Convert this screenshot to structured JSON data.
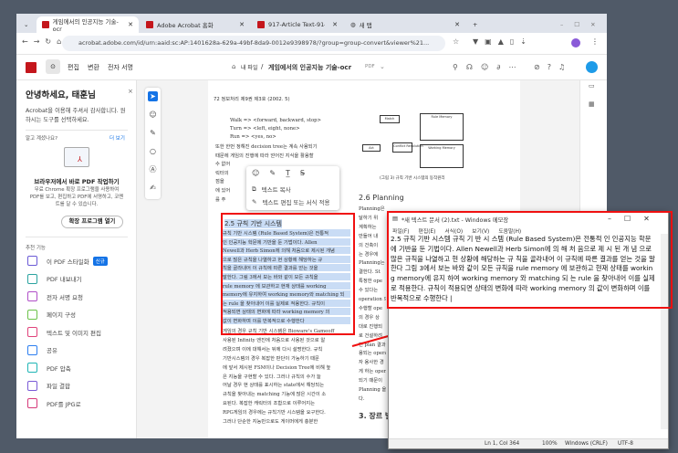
{
  "browser": {
    "tabs": [
      {
        "label": "게임에서의 인공지능 기술-ocr"
      },
      {
        "label": "Adobe Acrobat 홈화"
      },
      {
        "label": "917-Article Text-914-1-10-200"
      },
      {
        "label": "새 탭"
      }
    ],
    "url": "acrobat.adobe.com/id/urn:aaid:sc:AP:1401628a-629a-49bf-8da9-0012e9398978/?group=group-convert&viewer%21..."
  },
  "acrobat": {
    "menu": [
      "편집",
      "변환",
      "전자 서명"
    ],
    "breadcrumb_home": "내 파일",
    "separator": "/",
    "doc_title": "게임에서의 인공지능 기술-ocr",
    "doc_type": "PDF",
    "accent": "#c4161c"
  },
  "sidebar": {
    "greeting": "안녕하세요, 태훈님",
    "close": "×",
    "intro": "Acrobat을 이용해 주셔서 감사합니다. 원하시는 도구를 선택하세요.",
    "know_label": "알고 계셨나요?",
    "more": "더 보기",
    "promo_title": "브라우저에서 바로 PDF 작업하기",
    "promo_text": "무료 Chrome 확장 프로그램을 사용하여 PDF를 보고, 편집하고 PDF에 서명하고, 코멘트를 달 수 있습니다.",
    "promo_button": "확장 프로그램 열기",
    "recommended": "추천 기능",
    "features": [
      {
        "label": "이 PDF 스타일화",
        "badge": "신규",
        "color": "#6b5bd6"
      },
      {
        "label": "PDF 내보내기",
        "color": "#2aa3a0"
      },
      {
        "label": "전자 서명 요청",
        "color": "#b04fc8"
      },
      {
        "label": "페이지 구성",
        "color": "#6cc24a"
      },
      {
        "label": "텍스트 및 이미지 편집",
        "color": "#e0427a"
      },
      {
        "label": "공유",
        "color": "#2d7ff0"
      },
      {
        "label": "PDF 압축",
        "color": "#1fb5b5"
      },
      {
        "label": "파일 결합",
        "color": "#7a5bd6"
      },
      {
        "label": "PDF를 JPG로",
        "color": "#d63a7a"
      }
    ]
  },
  "context_menu": {
    "copy": "텍스트 복사",
    "edit": "텍스트 편집 또는 서식 적용"
  },
  "pdf": {
    "header": "72  정보처리 제9권 제3호 (2002. 5)",
    "code": [
      "Walk => <forward, backward, stop>",
      "Turn => <left, eight, none>",
      "Run => <yes, no>"
    ],
    "para1": [
      "또한 한번 정해진 decision tree는 계속 사용되기",
      "때문에 게임의 진행에 따라 얻어진 지식을 활용할",
      "수 없어",
      "릭터의",
      "점을",
      "에 있어",
      "를 주"
    ],
    "section": "2.5 규칙 기반 시스템",
    "selected": [
      "규칙 기반 시스템 (Rule Based System)은 전통적",
      "인 인공지능 학문에 기반을 둔 기법이다. Allen",
      "Newell과 Herb Simon에 의해 처음으로 제시된 개념",
      "으로 많은 규칙을 나열하고 현 상황에 해당하는 규",
      "칙을 골라내어 이 규칙에 따른 결과를 얻는 것을",
      "말한다. 그림 3에서 보는 바와 같이 모든 규칙을",
      "rule memory 에 보관하고 현재 상태를 working",
      "memory에 유지하여 working memory와 matching 되",
      "는 rule 을 찾아내어 이를 실제로 적용한다. 규칙이",
      "적용되면 상태의 변화에 따라 working memory 의",
      "값이 변화하며 이를 반복적으로 수행한다"
    ],
    "para2": [
      "게임의 경우 규칙 기반 시스템은 Bioware's Gameoff",
      "사용된 Infinity 엔진에 처음으로 사용된 것으로 알",
      "려졌으며 이에 대해서는 뒤에 다시 설명한다. 규칙",
      "기반시스템의 경우 복잡한 판단이 가능하기 때문",
      "에 앞서 제시된 FSM이나 Decision Tree에 비해 높",
      "은 지능을 구현할 수 있다. 그러나 규칙의 수가 늘",
      "어날 경우 현 상태를 표시하는 state에서 해당되는",
      "규칙을 찾아내는 matching 기능에 많은 시간이 소",
      "요된다. 복잡한 캐릭터의 조합으로 이루어지는",
      "RPG게임의 경우에는 규칙기반 시스템을 요구한다.",
      "그러나 단순한 지능만으로도 게이머에게 충분한"
    ],
    "diagram": {
      "match": "Match",
      "act": "Act",
      "conflict": "Conflict Resolution",
      "rule_memory": "Rule Memory",
      "working_memory": "Working Memory",
      "caption": "(그림 3) 규칙 기반 시스템의 동작원리"
    },
    "section26": "2.6 Planning",
    "planning": [
      "Planning은 현재의 상황에서 목표하는 상황에 도",
      "달하기 위",
      "계획하는",
      "만들어 내",
      "의 건축이",
      "는 경우에",
      "Planning는",
      "결한다. St",
      "특정한 ope",
      "수 있다는",
      "operation 의",
      "수행할 ope",
      "의 경우 상",
      "대로 진행되",
      "로 건설하려",
      "먼 plan 결과",
      "용되는 opera",
      "자 용사한 경",
      "게 하는 opera",
      "되기 때문이",
      "Planning 을 기",
      "다."
    ],
    "section3": "3. 장르 별"
  },
  "notepad": {
    "title": "*새 텍스트 문서 (2).txt - Windows 메모장",
    "menu": [
      "파일(F)",
      "편집(E)",
      "서식(O)",
      "보기(V)",
      "도움말(H)"
    ],
    "text": "2.5 규칙 기반 시스템 규칙 기 반 시 스템 (Rule Based System)은 전통적 인 인공지능 학문에 기반을 둔 기법이다. Allen Newell과 Herb Simon에 의 해 처 음으로 제 시 된 개 념 으로 많은 규칙을 나열하고 현 상황에 해당하는 규 칙을 골라내어 이 규칙에 따른 결과를 얻는 것을 말한다 그림 3에서 보는 바와 같이 모든 규칙을 rule memory 에 보관하고 현재 상태를 working memory에 유지 하여 working memory 와 matching 되 는 rule 을 찾아내어 이를 실제로 적용한다. 규칙이 적용되면 상태의 변화에 따라 working memory 의 값이 변화하며 이를 반복적으로 수행한다 |",
    "status": {
      "position": "Ln 1, Col 364",
      "zoom": "100%",
      "eol": "Windows (CRLF)",
      "encoding": "UTF-8"
    }
  }
}
